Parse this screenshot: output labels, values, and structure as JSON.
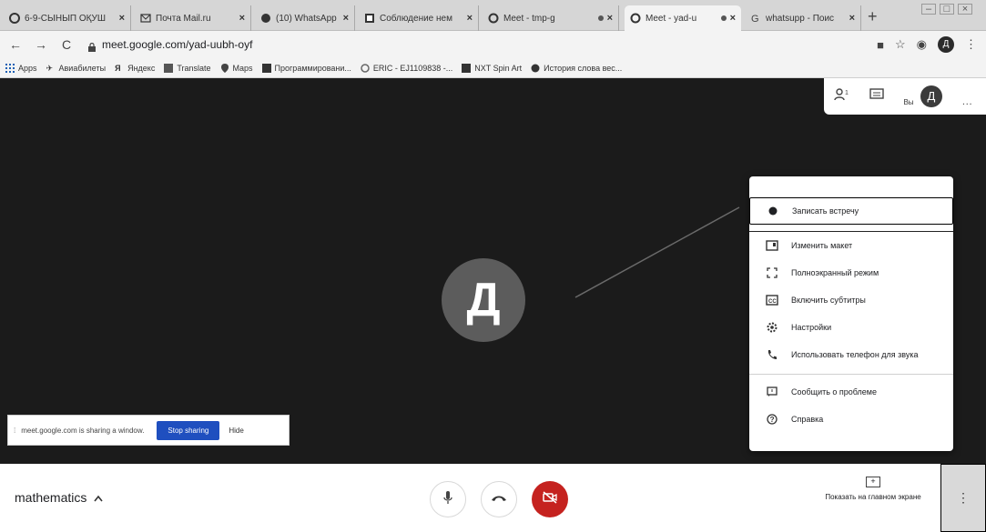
{
  "browser": {
    "tabs": [
      {
        "title": "6-9-СЫНЫП ОҚУШ",
        "icon": "circle-icon",
        "active": false
      },
      {
        "title": "Почта Mail.ru",
        "icon": "mail-icon",
        "active": false
      },
      {
        "title": "(10) WhatsApp",
        "icon": "whatsapp-icon",
        "active": false
      },
      {
        "title": "Соблюдение нем",
        "icon": "doc-icon",
        "active": false
      },
      {
        "title": "Meet - tmp-g",
        "icon": "meet-icon",
        "active": false
      },
      {
        "title": "Meet - yad-u",
        "icon": "meet-icon",
        "active": true
      },
      {
        "title": "whatsupp - Поис",
        "icon": "google-icon",
        "active": false
      }
    ],
    "new_tab": "+",
    "url": "meet.google.com/yad-uubh-oyf",
    "profile_initial": "Д",
    "bookmarks": [
      {
        "label": "Apps",
        "icon": "apps-icon"
      },
      {
        "label": "Авиабилеты",
        "icon": "plane-icon"
      },
      {
        "label": "Яндекс",
        "icon": "yandex-icon"
      },
      {
        "label": "Translate",
        "icon": "translate-icon"
      },
      {
        "label": "Maps",
        "icon": "maps-icon"
      },
      {
        "label": "Программировани...",
        "icon": "bookmark-icon"
      },
      {
        "label": "ERIC - EJ1109838 -...",
        "icon": "eric-icon"
      },
      {
        "label": "NXT Spin Art",
        "icon": "bookmark-icon"
      },
      {
        "label": "История слова вес...",
        "icon": "globe-icon"
      }
    ]
  },
  "meet": {
    "you_label": "Вы",
    "self_initial": "Д",
    "participant_initial": "Д",
    "menu": {
      "items": [
        {
          "label": "Записать встречу",
          "icon": "record-icon"
        },
        {
          "label": "Изменить макет",
          "icon": "layout-icon"
        },
        {
          "label": "Полноэкранный режим",
          "icon": "fullscreen-icon"
        },
        {
          "label": "Включить субтитры",
          "icon": "captions-icon"
        },
        {
          "label": "Настройки",
          "icon": "settings-icon"
        },
        {
          "label": "Использовать телефон для звука",
          "icon": "phone-icon"
        },
        {
          "label": "Сообщить о проблеме",
          "icon": "feedback-icon"
        },
        {
          "label": "Справка",
          "icon": "help-icon"
        }
      ]
    },
    "sharing": {
      "message": "meet.google.com is sharing a window.",
      "stop_label": "Stop sharing",
      "hide_label": "Hide"
    },
    "bottom": {
      "meeting_name": "mathematics",
      "present_label": "Показать на главном экране"
    }
  },
  "colors": {
    "meet_background": "#1b1b1b",
    "hangup_red": "#c5221f",
    "stop_sharing_blue": "#1f4fbf"
  }
}
